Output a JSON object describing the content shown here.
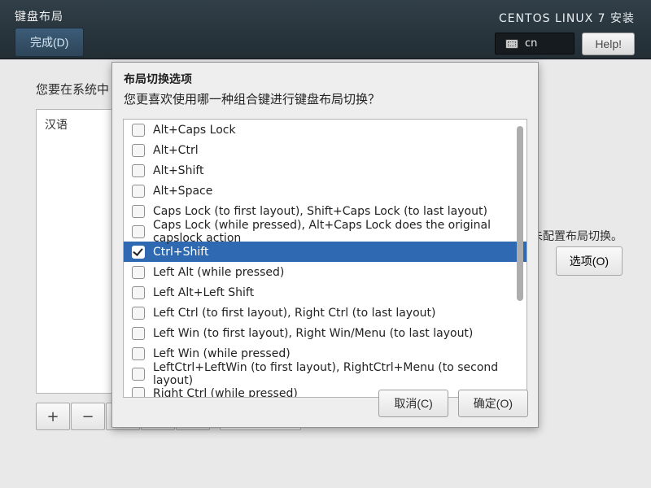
{
  "header": {
    "title": "键盘布局",
    "done": "完成(D)",
    "install_title": "CENTOS LINUX 7 安装",
    "lang_code": "cn",
    "help": "Help!"
  },
  "page": {
    "prompt": "您要在系统中",
    "layout_item": "汉语",
    "right_note": "未配置布局切换。",
    "options_btn": "选项(O)",
    "add_glyph": "+",
    "remove_glyph": "−"
  },
  "dialog": {
    "title": "布局切换选项",
    "subtitle": "您更喜欢使用哪一种组合键进行键盘布局切换？",
    "cancel": "取消(C)",
    "ok": "确定(O)",
    "options": [
      {
        "label": "Alt+Caps Lock",
        "checked": false,
        "selected": false
      },
      {
        "label": "Alt+Ctrl",
        "checked": false,
        "selected": false
      },
      {
        "label": "Alt+Shift",
        "checked": false,
        "selected": false
      },
      {
        "label": "Alt+Space",
        "checked": false,
        "selected": false
      },
      {
        "label": "Caps Lock (to first layout), Shift+Caps Lock (to last layout)",
        "checked": false,
        "selected": false
      },
      {
        "label": "Caps Lock (while pressed), Alt+Caps Lock does the original capslock action",
        "checked": false,
        "selected": false
      },
      {
        "label": "Ctrl+Shift",
        "checked": true,
        "selected": true
      },
      {
        "label": "Left Alt (while pressed)",
        "checked": false,
        "selected": false
      },
      {
        "label": "Left Alt+Left Shift",
        "checked": false,
        "selected": false
      },
      {
        "label": "Left Ctrl (to first layout), Right Ctrl (to last layout)",
        "checked": false,
        "selected": false
      },
      {
        "label": "Left Win (to first layout), Right Win/Menu (to last layout)",
        "checked": false,
        "selected": false
      },
      {
        "label": "Left Win (while pressed)",
        "checked": false,
        "selected": false
      },
      {
        "label": "LeftCtrl+LeftWin (to first layout), RightCtrl+Menu (to second layout)",
        "checked": false,
        "selected": false
      },
      {
        "label": "Right Ctrl (while pressed)",
        "checked": false,
        "selected": false
      }
    ]
  }
}
